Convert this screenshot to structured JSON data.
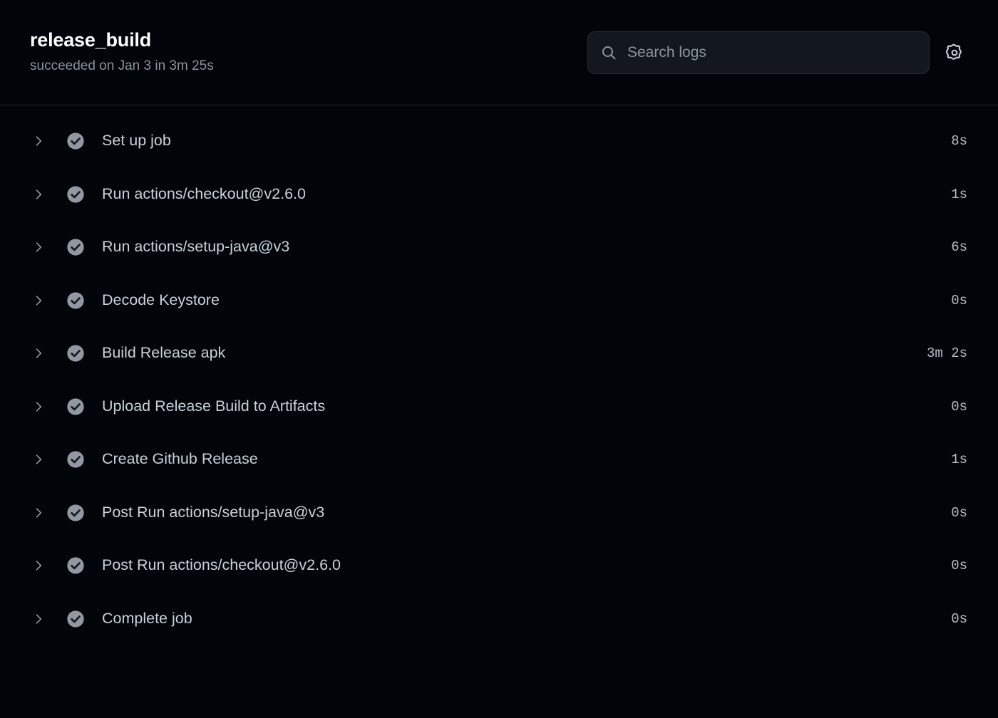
{
  "header": {
    "title": "release_build",
    "subtitle": "succeeded on Jan 3 in 3m 25s",
    "search": {
      "placeholder": "Search logs",
      "value": "",
      "icon": "search-icon"
    },
    "settings": {
      "icon": "gear-icon",
      "label": "Settings"
    }
  },
  "colors": {
    "background": "#010409",
    "divider": "#21262d",
    "title_text": "#ffffff",
    "muted_text": "#8b949e",
    "label_text": "#c9d1d9",
    "status_success": "#9198a1",
    "search_field": "#13171e",
    "search_border": "#272d36"
  },
  "steps": [
    {
      "label": "Set up job",
      "duration": "8s",
      "status": "success",
      "expanded": false,
      "chevron": "chevron-right-icon"
    },
    {
      "label": "Run actions/checkout@v2.6.0",
      "duration": "1s",
      "status": "success",
      "expanded": false,
      "chevron": "chevron-right-icon"
    },
    {
      "label": "Run actions/setup-java@v3",
      "duration": "6s",
      "status": "success",
      "expanded": false,
      "chevron": "chevron-right-icon"
    },
    {
      "label": "Decode Keystore",
      "duration": "0s",
      "status": "success",
      "expanded": false,
      "chevron": "chevron-right-icon"
    },
    {
      "label": "Build Release apk",
      "duration": "3m 2s",
      "status": "success",
      "expanded": false,
      "chevron": "chevron-right-icon"
    },
    {
      "label": "Upload Release Build to Artifacts",
      "duration": "0s",
      "status": "success",
      "expanded": false,
      "chevron": "chevron-right-icon"
    },
    {
      "label": "Create Github Release",
      "duration": "1s",
      "status": "success",
      "expanded": false,
      "chevron": "chevron-right-icon"
    },
    {
      "label": "Post Run actions/setup-java@v3",
      "duration": "0s",
      "status": "success",
      "expanded": false,
      "chevron": "chevron-right-icon"
    },
    {
      "label": "Post Run actions/checkout@v2.6.0",
      "duration": "0s",
      "status": "success",
      "expanded": false,
      "chevron": "chevron-right-icon"
    },
    {
      "label": "Complete job",
      "duration": "0s",
      "status": "success",
      "expanded": false,
      "chevron": "chevron-right-icon"
    }
  ]
}
